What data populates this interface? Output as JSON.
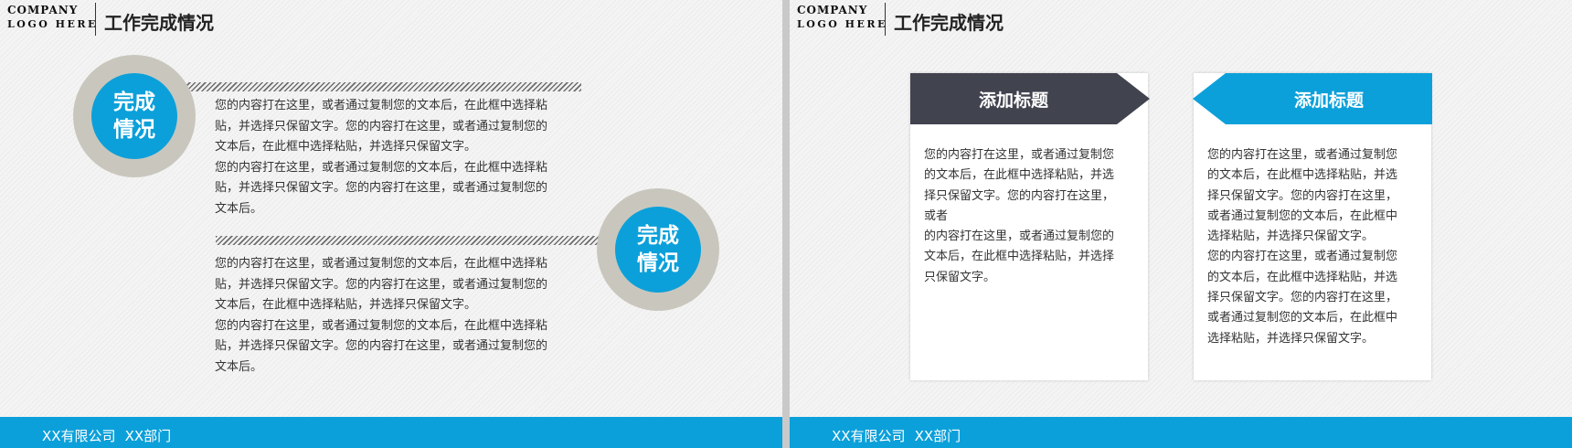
{
  "logo": {
    "line1": "COMPANY",
    "line2": "LOGO HERE"
  },
  "page_title": "工作完成情况",
  "footer": {
    "company": "XX有限公司",
    "department": "XX部门"
  },
  "colors": {
    "accent": "#0ca0da",
    "dark": "#41434f",
    "circle_ring": "#c9c7bd",
    "footer": "#0ca0da"
  },
  "slide1": {
    "badge_top": {
      "line1": "完成",
      "line2": "情况"
    },
    "badge_bottom": {
      "line1": "完成",
      "line2": "情况"
    },
    "block1": [
      "您的内容打在这里，或者通过复制您的文本后，在此框中选择粘",
      "贴，并选择只保留文字。您的内容打在这里，或者通过复制您的",
      "文本后，在此框中选择粘贴，并选择只保留文字。",
      "您的内容打在这里，或者通过复制您的文本后，在此框中选择粘",
      "贴，并选择只保留文字。您的内容打在这里，或者通过复制您的",
      "文本后。"
    ],
    "block2": [
      "您的内容打在这里，或者通过复制您的文本后，在此框中选择粘",
      "贴，并选择只保留文字。您的内容打在这里，或者通过复制您的",
      "文本后，在此框中选择粘贴，并选择只保留文字。",
      "您的内容打在这里，或者通过复制您的文本后，在此框中选择粘",
      "贴，并选择只保留文字。您的内容打在这里，或者通过复制您的",
      "文本后。"
    ]
  },
  "slide2": {
    "card_left": {
      "title": "添加标题",
      "lines": [
        "您的内容打在这里，或者通过复制您",
        "的文本后，在此框中选择粘贴，并选",
        "择只保留文字。您的内容打在这里，",
        "或者",
        "的内容打在这里，或者通过复制您的",
        "文本后，在此框中选择粘贴，并选择",
        "只保留文字。"
      ]
    },
    "card_right": {
      "title": "添加标题",
      "lines": [
        "您的内容打在这里，或者通过复制您",
        "的文本后，在此框中选择粘贴，并选",
        "择只保留文字。您的内容打在这里，",
        "或者通过复制您的文本后，在此框中",
        "选择粘贴，并选择只保留文字。",
        "您的内容打在这里，或者通过复制您",
        "的文本后，在此框中选择粘贴，并选",
        "择只保留文字。您的内容打在这里，",
        "或者通过复制您的文本后，在此框中",
        "选择粘贴，并选择只保留文字。"
      ]
    }
  }
}
